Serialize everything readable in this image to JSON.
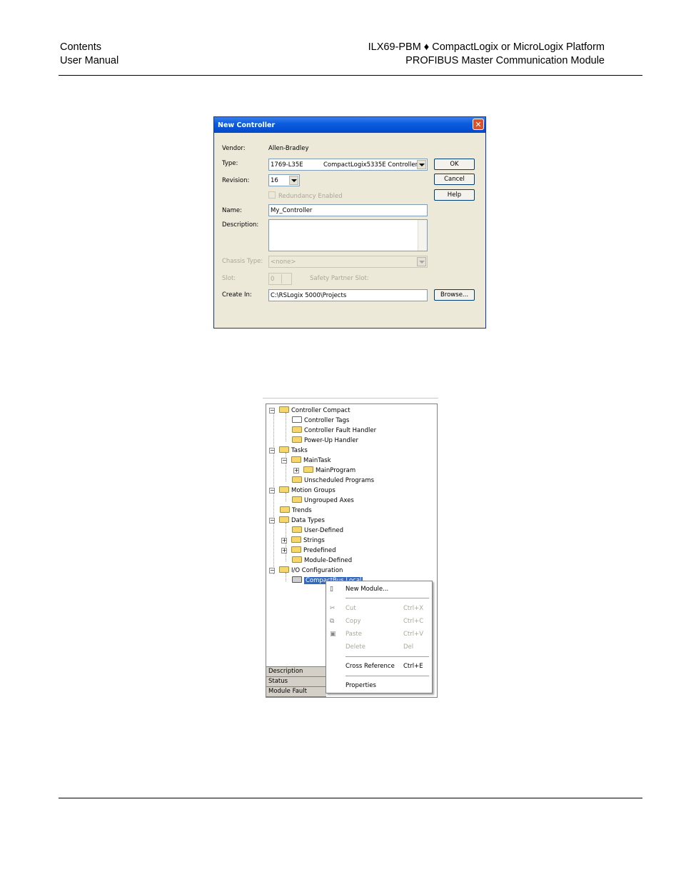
{
  "header": {
    "left_line1": "Contents",
    "left_line2": "User Manual",
    "right_line1": "ILX69-PBM ♦ CompactLogix or MicroLogix Platform",
    "right_line2": "PROFIBUS Master Communication Module"
  },
  "dialog": {
    "title": "New Controller",
    "vendor_label": "Vendor:",
    "vendor_value": "Allen-Bradley",
    "type_label": "Type:",
    "type_value": "1769-L35E",
    "type_desc": "CompactLogix5335E Controller",
    "revision_label": "Revision:",
    "revision_value": "16",
    "redundancy_label": "Redundancy Enabled",
    "name_label": "Name:",
    "name_value": "My_Controller",
    "description_label": "Description:",
    "chassis_label": "Chassis Type:",
    "chassis_value": "<none>",
    "slot_label": "Slot:",
    "slot_value": "0",
    "safety_label": "Safety Partner Slot:",
    "create_label": "Create In:",
    "create_value": "C:\\RSLogix 5000\\Projects",
    "ok_label": "OK",
    "cancel_label": "Cancel",
    "help_label": "Help",
    "browse_label": "Browse..."
  },
  "tree": {
    "items": [
      "Controller Compact",
      "Controller Tags",
      "Controller Fault Handler",
      "Power-Up Handler",
      "Tasks",
      "MainTask",
      "MainProgram",
      "Unscheduled Programs",
      "Motion Groups",
      "Ungrouped Axes",
      "Trends",
      "Data Types",
      "User-Defined",
      "Strings",
      "Predefined",
      "Module-Defined",
      "I/O Configuration",
      "CompactBus Local"
    ],
    "props": [
      "Description",
      "Status",
      "Module Fault"
    ]
  },
  "menu": {
    "new_module": "New Module...",
    "cut": "Cut",
    "cut_key": "Ctrl+X",
    "copy": "Copy",
    "copy_key": "Ctrl+C",
    "paste": "Paste",
    "paste_key": "Ctrl+V",
    "delete": "Delete",
    "delete_key": "Del",
    "cross_ref": "Cross Reference",
    "cross_ref_key": "Ctrl+E",
    "properties": "Properties"
  }
}
